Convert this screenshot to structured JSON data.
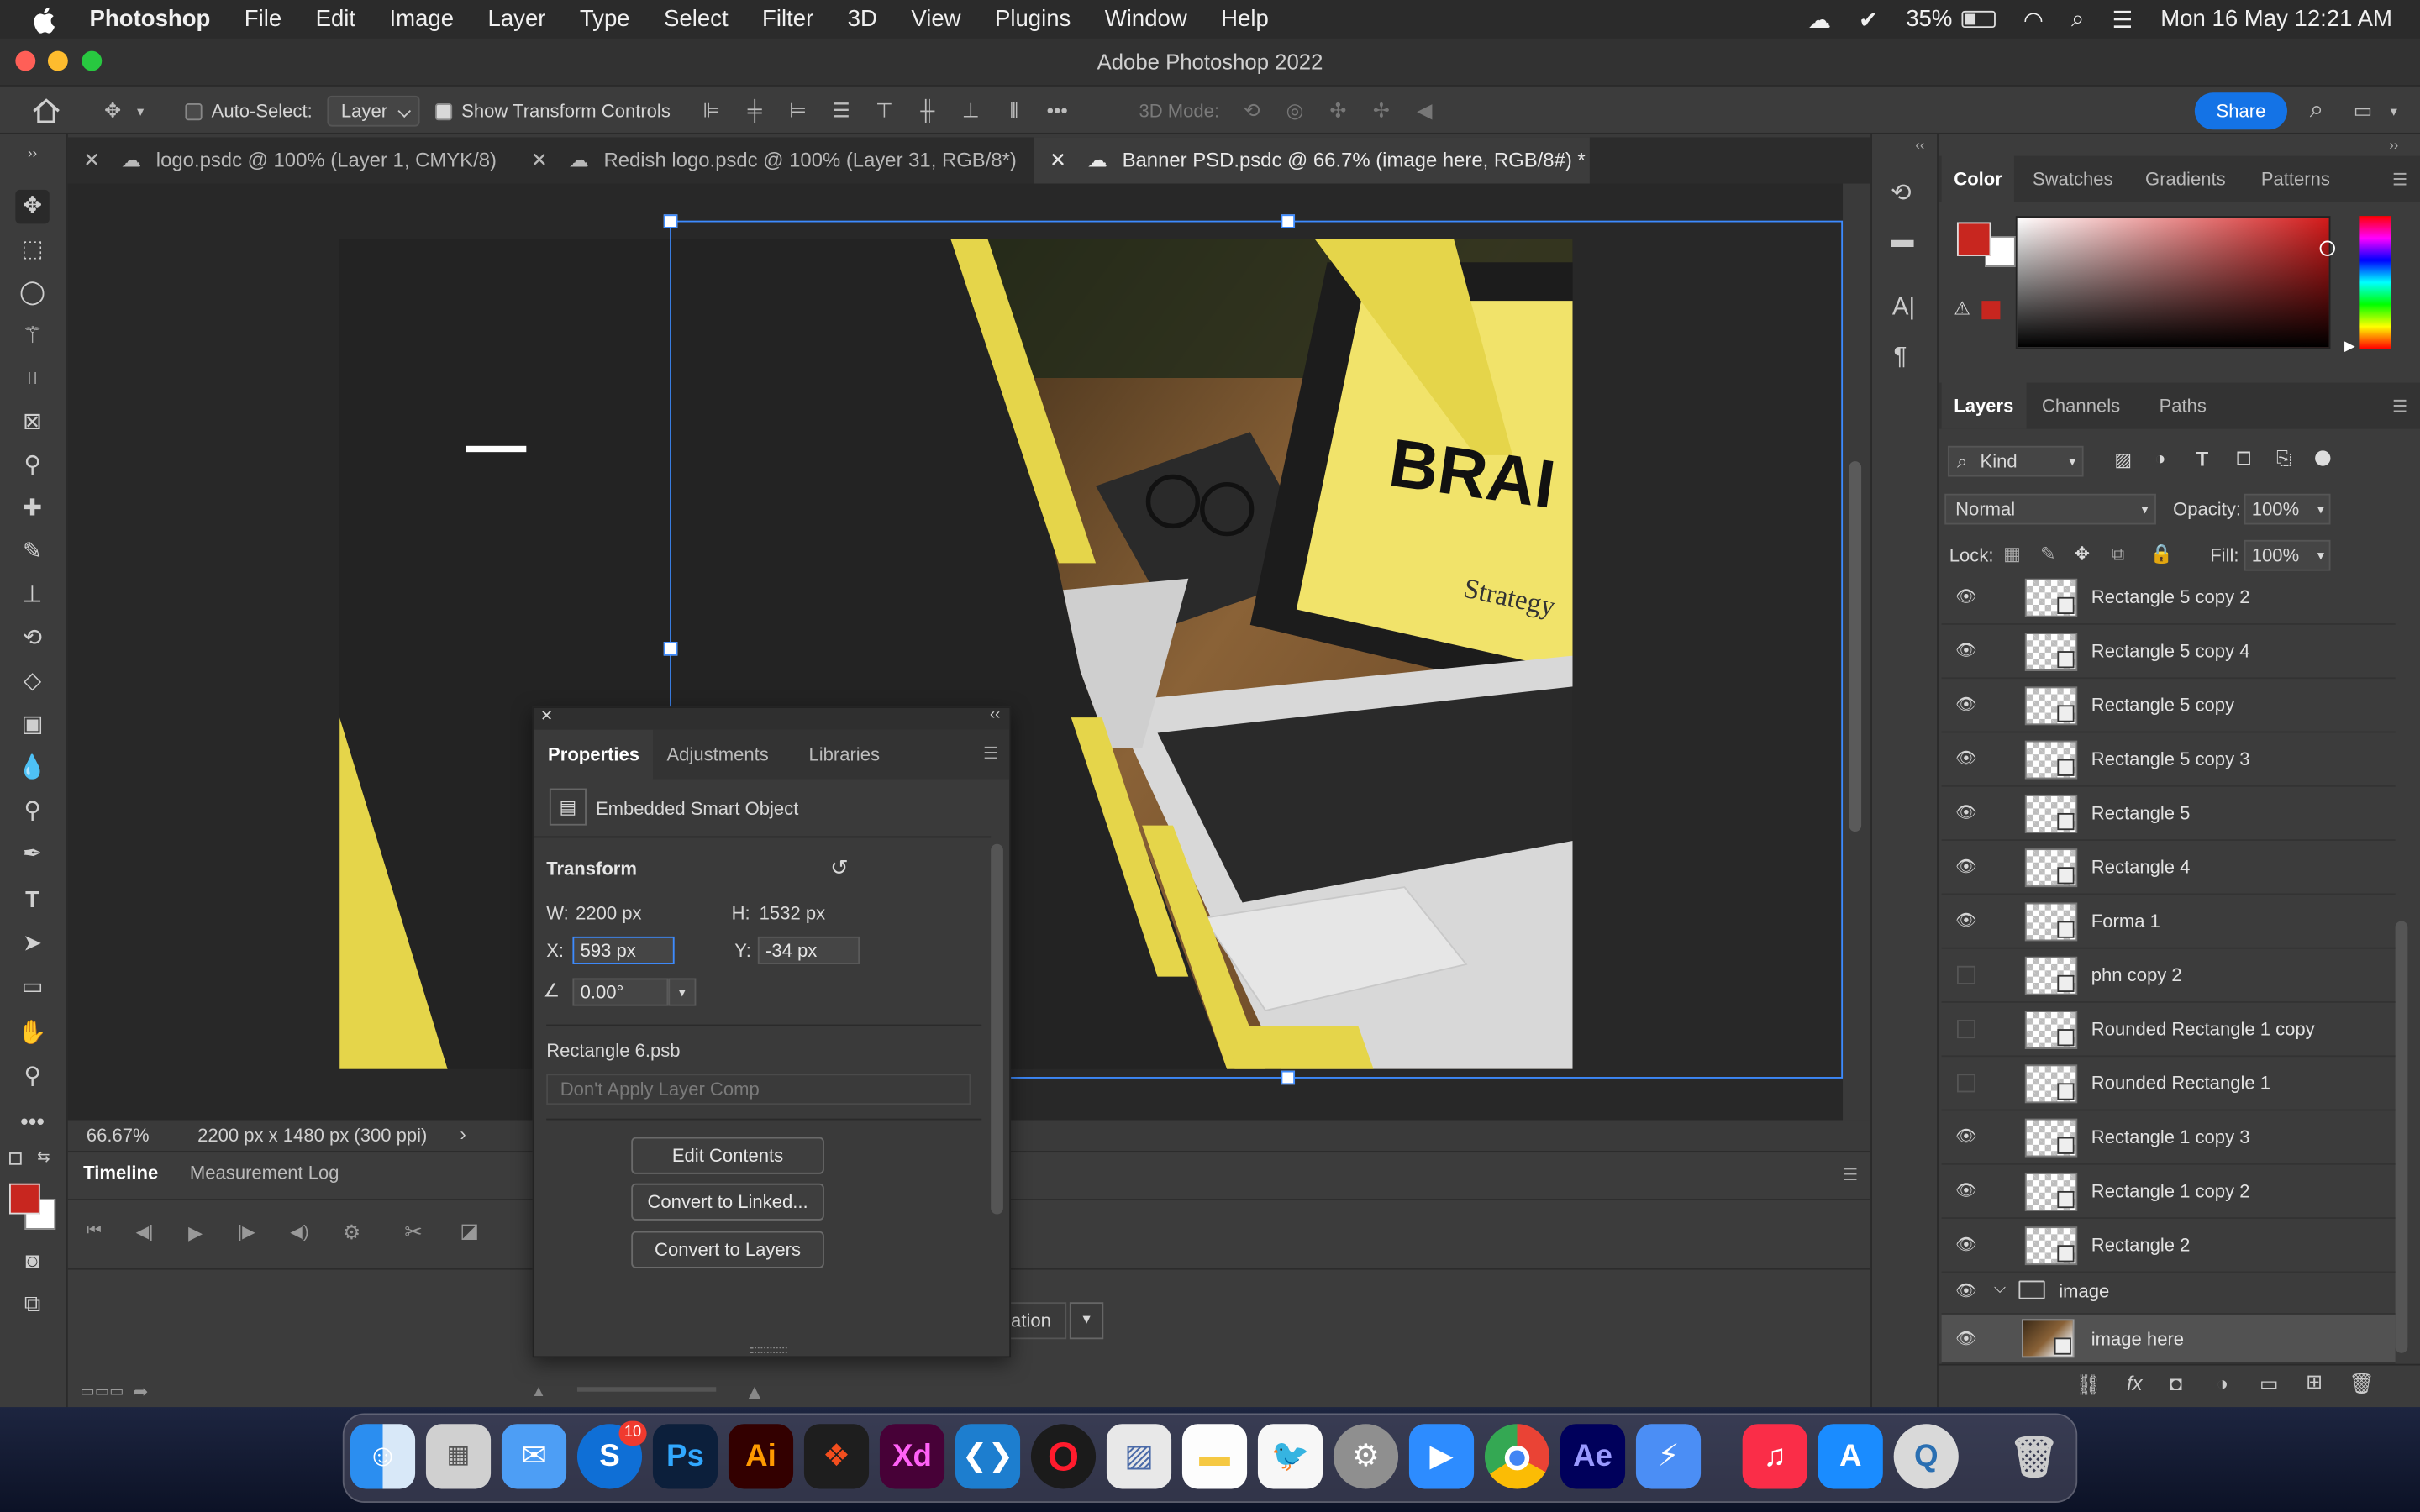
{
  "menubar": {
    "app_name": "Photoshop",
    "items": [
      "File",
      "Edit",
      "Image",
      "Layer",
      "Type",
      "Select",
      "Filter",
      "3D",
      "View",
      "Plugins",
      "Window",
      "Help"
    ],
    "battery": "35%",
    "clock": "Mon 16 May  12:21 AM"
  },
  "window": {
    "title": "Adobe Photoshop 2022"
  },
  "options": {
    "auto_select_label": "Auto-Select:",
    "auto_select_value": "Layer",
    "show_transform_label": "Show Transform Controls",
    "mode_3d_label": "3D Mode:",
    "share_label": "Share"
  },
  "doc_tabs": [
    {
      "label": "logo.psdc @ 100% (Layer 1, CMYK/8)"
    },
    {
      "label": "Redish logo.psdc @ 100% (Layer 31, RGB/8*)"
    },
    {
      "label": "Banner PSD.psdc @ 66.7% (image here, RGB/8#) *"
    }
  ],
  "canvas": {
    "brand_text": "BRAI",
    "strategy_text": "Strategy",
    "accent_color": "#e5d54a"
  },
  "status": {
    "zoom": "66.67%",
    "doc_size": "2200 px x 1480 px (300 ppi)"
  },
  "timeline": {
    "tabs": [
      "Timeline",
      "Measurement Log"
    ],
    "partial_button": "ation"
  },
  "properties": {
    "tabs": [
      "Properties",
      "Adjustments",
      "Libraries"
    ],
    "object_type": "Embedded Smart Object",
    "transform_label": "Transform",
    "w_label": "W:",
    "w_value": "2200 px",
    "h_label": "H:",
    "h_value": "1532 px",
    "x_label": "X:",
    "x_value": "593 px",
    "y_label": "Y:",
    "y_value": "-34 px",
    "angle_value": "0.00°",
    "file_name": "Rectangle 6.psb",
    "layer_comp": "Don't Apply Layer Comp",
    "buttons": [
      "Edit Contents",
      "Convert to Linked...",
      "Convert to Layers"
    ]
  },
  "color_panel": {
    "tabs": [
      "Color",
      "Swatches",
      "Gradients",
      "Patterns"
    ],
    "fg_color": "#c8261f"
  },
  "layers_panel": {
    "tabs": [
      "Layers",
      "Channels",
      "Paths"
    ],
    "kind_label": "Kind",
    "blend_mode": "Normal",
    "opacity_label": "Opacity:",
    "opacity_value": "100%",
    "lock_label": "Lock:",
    "fill_label": "Fill:",
    "fill_value": "100%",
    "layers": [
      {
        "name": "Rectangle 5 copy 2",
        "visible": true
      },
      {
        "name": "Rectangle 5 copy 4",
        "visible": true
      },
      {
        "name": "Rectangle 5 copy",
        "visible": true
      },
      {
        "name": "Rectangle 5 copy 3",
        "visible": true
      },
      {
        "name": "Rectangle 5",
        "visible": true
      },
      {
        "name": "Rectangle 4",
        "visible": true
      },
      {
        "name": "Forma 1",
        "visible": true
      },
      {
        "name": "phn copy 2",
        "visible": false
      },
      {
        "name": "Rounded Rectangle 1 copy",
        "visible": false
      },
      {
        "name": "Rounded Rectangle 1",
        "visible": false
      },
      {
        "name": "Rectangle 1 copy 3",
        "visible": true
      },
      {
        "name": "Rectangle 1 copy 2",
        "visible": true
      },
      {
        "name": "Rectangle 2",
        "visible": true
      }
    ],
    "group_name": "image",
    "selected_layer": "image here"
  },
  "dock": {
    "badge": "10",
    "apps": [
      "Finder",
      "Launchpad",
      "Mail",
      "Skype",
      "Photoshop",
      "Illustrator",
      "Figma",
      "XD",
      "VS Code",
      "Opera",
      "Preview",
      "Notes",
      "Swift Playgrounds",
      "System Preferences",
      "Zoom",
      "Chrome",
      "After Effects",
      "Toolbox",
      "Music",
      "App Store",
      "QuickTime",
      "Trash"
    ],
    "labels": {
      "ps": "Ps",
      "ai": "Ai",
      "xd": "Xd",
      "ae": "Ae"
    }
  }
}
